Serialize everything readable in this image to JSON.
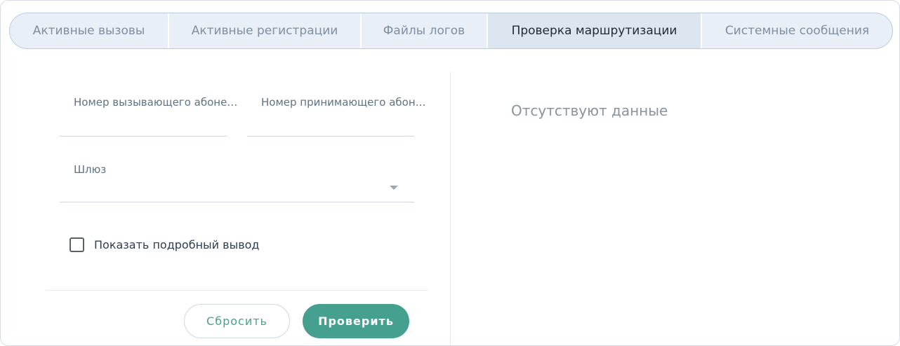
{
  "tabs": [
    {
      "label": "Активные вызовы",
      "active": false
    },
    {
      "label": "Активные регистрации",
      "active": false
    },
    {
      "label": "Файлы логов",
      "active": false
    },
    {
      "label": "Проверка маршрутизации",
      "active": true
    },
    {
      "label": "Системные сообщения",
      "active": false
    }
  ],
  "form": {
    "caller_label": "Номер вызывающего абонента",
    "caller_value": "",
    "callee_label": "Номер принимающего абонента",
    "callee_value": "",
    "gateway_label": "Шлюз",
    "gateway_value": "",
    "verbose_label": "Показать подробный вывод",
    "verbose_checked": false
  },
  "buttons": {
    "reset_label": "Сбросить",
    "check_label": "Проверить"
  },
  "result": {
    "empty_text": "Отсутствуют данные"
  },
  "icons": {
    "dropdown": "chevron-down-icon"
  },
  "colors": {
    "accent": "#45a08f",
    "tab_bg": "#e9eff6",
    "tab_active_bg": "#dce6f0"
  }
}
